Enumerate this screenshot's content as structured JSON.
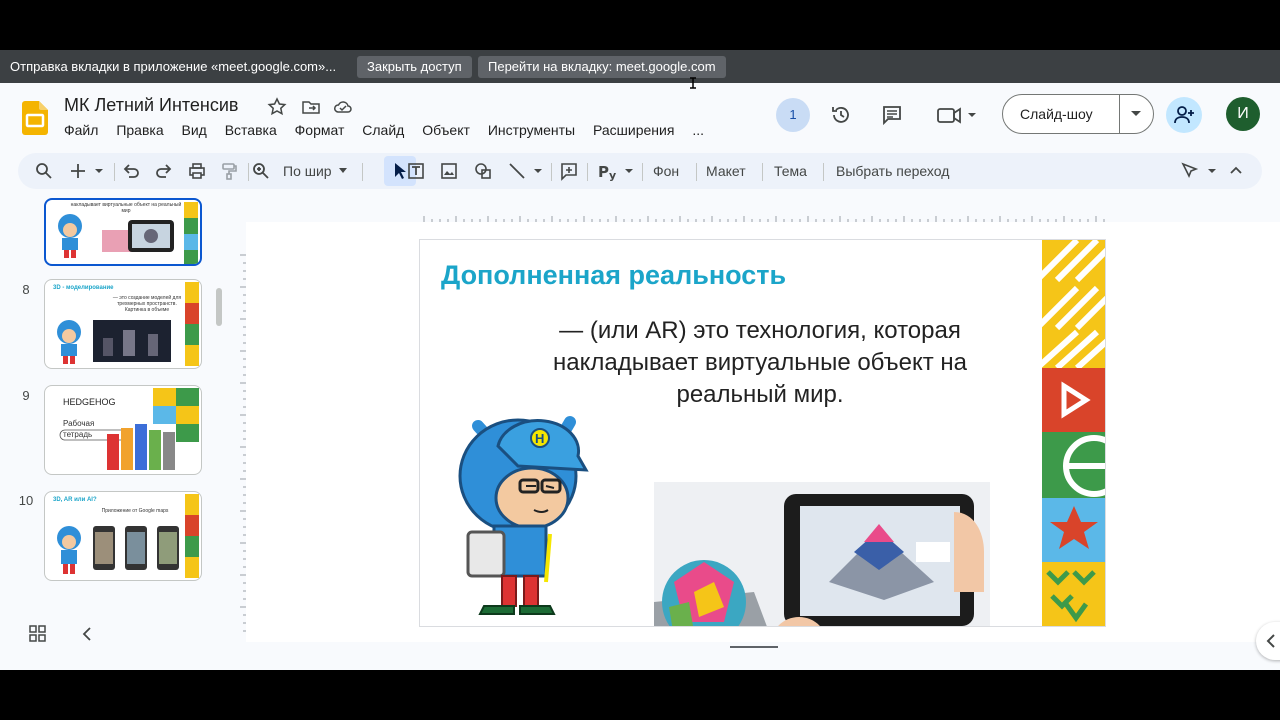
{
  "share_bar": {
    "message": "Отправка вкладки в приложение «meet.google.com»...",
    "stop_button": "Закрыть доступ",
    "switch_button": "Перейти на вкладку: meet.google.com"
  },
  "header": {
    "title": "МК Летний Интенсив",
    "menu": [
      "Файл",
      "Правка",
      "Вид",
      "Вставка",
      "Формат",
      "Слайд",
      "Объект",
      "Инструменты",
      "Расширения",
      "..."
    ],
    "participants_count": "1",
    "slideshow_label": "Слайд-шоу",
    "user_initial": "И"
  },
  "toolbar": {
    "zoom_label": "По шир",
    "background_label": "Фон",
    "layout_label": "Макет",
    "theme_label": "Тема",
    "transition_label": "Выбрать переход"
  },
  "filmstrip": {
    "slides": [
      {
        "number": "",
        "title": "",
        "text": "накладывает виртуальные объект на реальный мир"
      },
      {
        "number": "8",
        "title": "3D - моделирование",
        "text": "— это создание моделей для трехмерных пространств. Картинка в объеме"
      },
      {
        "number": "9",
        "title": "HEDGEHOG",
        "text": "Рабочая тетрадь"
      },
      {
        "number": "10",
        "title": "3D, AR или AI?",
        "text": "Приложение от Google maps"
      }
    ]
  },
  "slide": {
    "title": "Дополненная реальность",
    "body": "— (или AR) это технология, которая накладывает виртуальные объект на реальный мир.",
    "hat_letter": "H"
  },
  "colors": {
    "accent_title": "#1ba5c9",
    "selection_blue": "#0b57d0",
    "share_bar_bg": "#3c4043",
    "deco_yellow": "#f5c518",
    "deco_red": "#d9442a",
    "deco_green": "#3d9a4a",
    "deco_blue": "#5bb8e8"
  }
}
